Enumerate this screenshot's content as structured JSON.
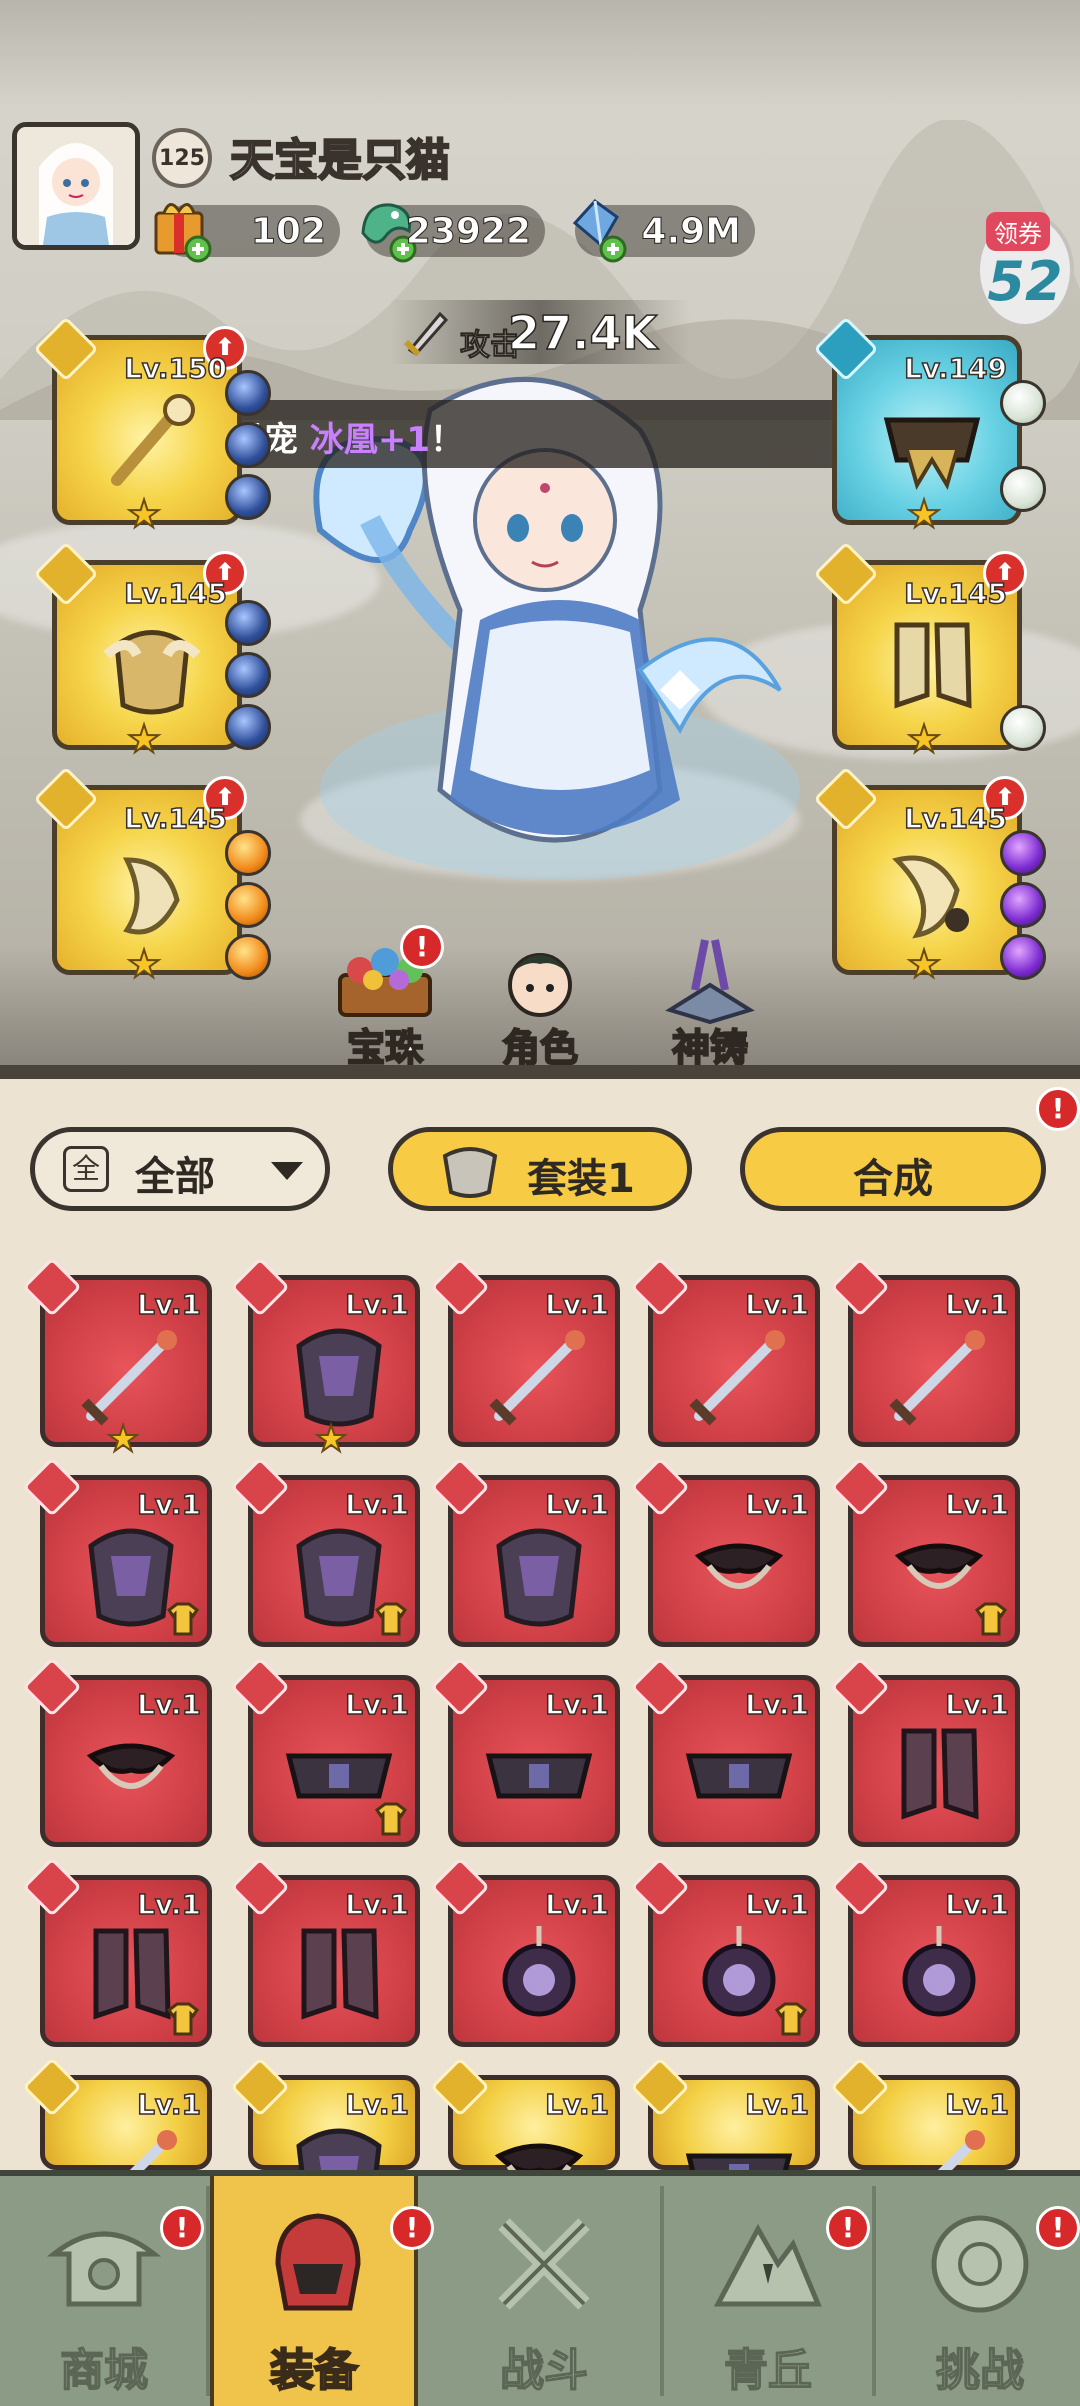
{
  "player": {
    "level": "125",
    "name": "天宝是只猫"
  },
  "resources": [
    {
      "name": "gift-box-icon",
      "value": "102"
    },
    {
      "name": "dragon-coin-icon",
      "value": "23922"
    },
    {
      "name": "blue-crystal-icon",
      "value": "4.9M"
    }
  ],
  "coupon": {
    "tag": "领券",
    "number": "52"
  },
  "attack": {
    "label": "攻击",
    "value": "27.4K"
  },
  "banner": {
    "prefix": "出了非凡灵宠",
    "highlight": "冰凰+1",
    "suffix": "！"
  },
  "equipment_left": [
    {
      "level": "Lv.150",
      "type_icon": "sword-icon",
      "gems": [
        "blue",
        "blue",
        "blue"
      ]
    },
    {
      "level": "Lv.145",
      "type_icon": "armor-icon",
      "gems": [
        "blue",
        "blue",
        "blue"
      ]
    },
    {
      "level": "Lv.145",
      "type_icon": "shoulder-icon",
      "gems": [
        "orange",
        "orange",
        "orange"
      ]
    }
  ],
  "equipment_right": [
    {
      "level": "Lv.149",
      "type_icon": "belt-icon",
      "gems": [
        "white",
        "white"
      ]
    },
    {
      "level": "Lv.145",
      "type_icon": "boots-icon",
      "gems": [
        "white"
      ]
    },
    {
      "level": "Lv.145",
      "type_icon": "amulet-icon",
      "gems": [
        "purple",
        "purple",
        "purple"
      ]
    }
  ],
  "shortcuts": [
    {
      "label": "宝珠"
    },
    {
      "label": "角色"
    },
    {
      "label": "神铸"
    }
  ],
  "toolbar": {
    "filter_icon": "全",
    "filter_label": "全部",
    "set_label": "套装1",
    "compose_label": "合成"
  },
  "item_level": "Lv.1",
  "items": [
    {
      "type": "sword",
      "color": "red",
      "star": true
    },
    {
      "type": "armor",
      "color": "red",
      "star": true
    },
    {
      "type": "sword",
      "color": "red"
    },
    {
      "type": "sword",
      "color": "red"
    },
    {
      "type": "sword",
      "color": "red"
    },
    {
      "type": "armor",
      "color": "red",
      "badge": true
    },
    {
      "type": "armor",
      "color": "red",
      "badge": true
    },
    {
      "type": "armor",
      "color": "red"
    },
    {
      "type": "shoulder",
      "color": "red"
    },
    {
      "type": "shoulder",
      "color": "red",
      "badge": true
    },
    {
      "type": "shoulder",
      "color": "red"
    },
    {
      "type": "belt",
      "color": "red",
      "badge": true
    },
    {
      "type": "belt",
      "color": "red"
    },
    {
      "type": "belt",
      "color": "red"
    },
    {
      "type": "boots",
      "color": "red"
    },
    {
      "type": "boots",
      "color": "red",
      "badge": true
    },
    {
      "type": "boots",
      "color": "red"
    },
    {
      "type": "amulet",
      "color": "red"
    },
    {
      "type": "amulet",
      "color": "red",
      "badge": true
    },
    {
      "type": "amulet",
      "color": "red"
    },
    {
      "type": "sword",
      "color": "gold"
    },
    {
      "type": "armor",
      "color": "gold"
    },
    {
      "type": "shoulder",
      "color": "gold"
    },
    {
      "type": "belt",
      "color": "gold"
    },
    {
      "type": "sword",
      "color": "gold"
    }
  ],
  "nav": [
    {
      "label": "商城",
      "alert": "!",
      "active": false
    },
    {
      "label": "装备",
      "alert": "!",
      "active": true
    },
    {
      "label": "战斗",
      "alert": "",
      "active": false
    },
    {
      "label": "青丘",
      "alert": "!",
      "active": false
    },
    {
      "label": "挑战",
      "alert": "!",
      "active": false
    }
  ],
  "colors": {
    "slot_gold": "#f6d54a",
    "slot_cyan": "#69d2e4",
    "item_red": "#cf3f46",
    "accent_yellow": "#f7cc44",
    "alert_red": "#d7282a"
  }
}
